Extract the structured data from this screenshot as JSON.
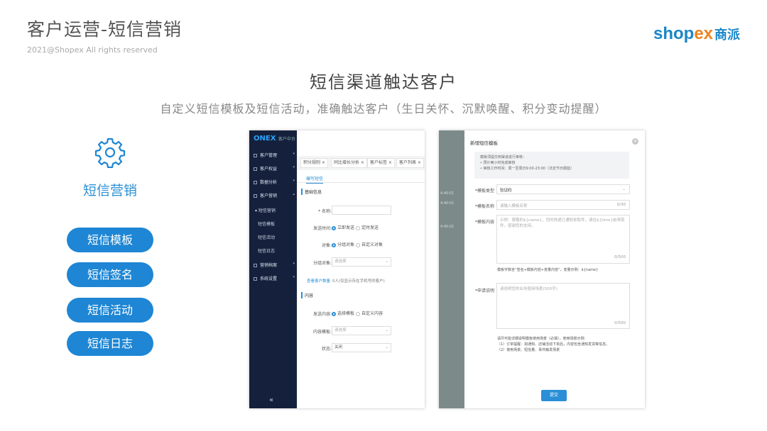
{
  "header": {
    "title": "客户运营-短信营销",
    "copyright": "2021@Shopex All rights reserved",
    "logo_main": "shop",
    "logo_x": "ex",
    "logo_cn": "商派"
  },
  "hero": {
    "headline": "短信渠道触达客户",
    "subline": "自定义短信模板及短信活动，准确触达客户（生日关怀、沉默唤醒、积分变动提醒）"
  },
  "feature": {
    "icon": "gear-icon",
    "label": "短信营销",
    "buttons": [
      "短信模板",
      "短信签名",
      "短信活动",
      "短信日志"
    ],
    "accent": "#1e86d4"
  },
  "shot1": {
    "brand": "ONEX",
    "brand_sub": "客户中台",
    "nav": [
      "客户管理",
      "客户权益",
      "数据分析",
      "客户营销"
    ],
    "nav_open": "短信营销",
    "subnav": [
      "短信模板",
      "短信活动",
      "短信日志"
    ],
    "nav_more": [
      "营销档案",
      "系统设置"
    ],
    "collapse": "«",
    "tabs": [
      "积分规则 ×",
      "同比增长分析 ×",
      "客户标签 ×",
      "客户列表 ×"
    ],
    "active_tab": "编写短信",
    "section_basic": "基础信息",
    "fields": {
      "name_label": "* 名称:",
      "send_label": "发送时间:",
      "send_opt1": "立即发送",
      "send_opt2": "定时发送",
      "target_label": "对象:",
      "target_opt1": "分组对象",
      "target_opt2": "自定义对象",
      "group_label": "分组对象:",
      "group_placeholder": "请选择"
    },
    "count_link": "查看客户数量",
    "count_text": "0人(仅显示存在手机号的客户)",
    "section_content": "内容",
    "content_fields": {
      "content_label": "发送内容:",
      "content_opt1": "选择模板",
      "content_opt2": "自定义内容",
      "template_label": "内容模板:",
      "template_placeholder": "请选择",
      "status_label": "状态:",
      "status_value": "关闭"
    }
  },
  "shot2": {
    "bg_rows": [
      "4:40:01",
      "4:40:01",
      "4:40:01"
    ],
    "title": "新增短信模板",
    "close": "×",
    "notice": [
      "模板须提交到渠道进行审核：",
      "• 预计两小时完成审核",
      "• 审核工作时间：周一至周日9:00-23:00（法定节日顺延）"
    ],
    "type_label": "*模板类型",
    "type_value": "验证码",
    "name_label": "*模板名称",
    "name_placeholder": "请输入模板名称",
    "name_count": "0/30",
    "content_label": "*模板内容",
    "content_placeholder": "示例：尊敬的${name}，您的快递已通知你取件，请在${time}前来取件，感谢您的支持。",
    "content_count": "0/500",
    "content_tip": "模板字数含“签名+模板内容+变量内容”，变量示例：${name}",
    "reason_label": "*申请说明",
    "reason_placeholder": "请说明您的业务使用场景(500字)",
    "reason_count": "0/500",
    "bottom_notes": [
      "请尽可能详细说明模板使用场景（必填），使用场景示例：",
      "（1）订单提醒：如通知、店铺活动下单后，内容包含通知发货等信息。",
      "（2）使用场景、短信量、事件触发场景"
    ],
    "submit": "提交"
  }
}
